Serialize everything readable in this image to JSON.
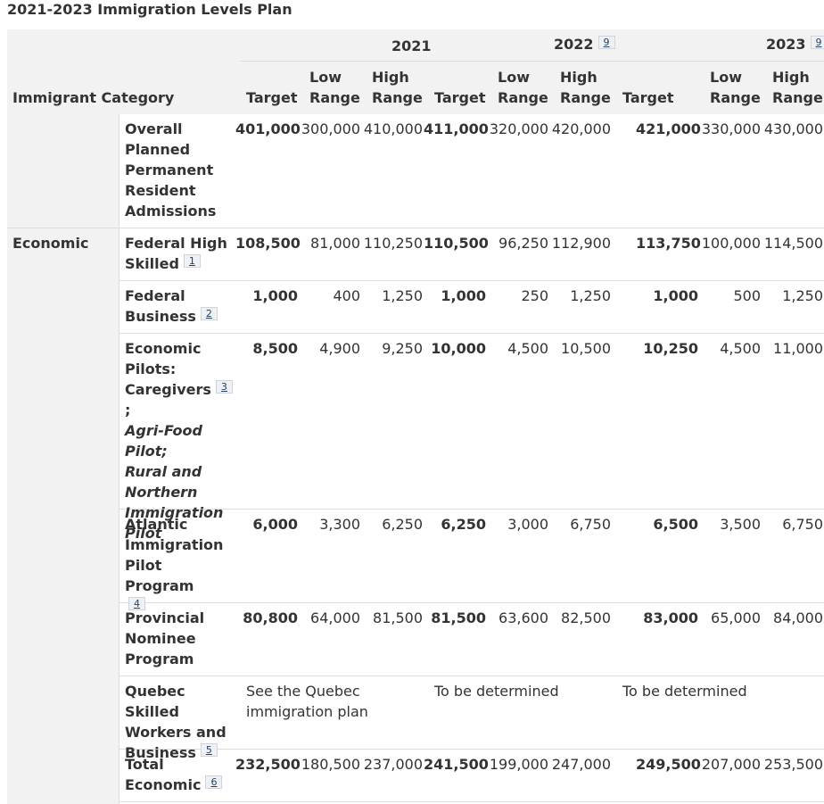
{
  "caption": "2021-2023 Immigration Levels Plan",
  "header": {
    "category_label": "Immigrant Category",
    "years": [
      {
        "year": "2021",
        "footnote": ""
      },
      {
        "year": "2022",
        "footnote": "9"
      },
      {
        "year": "2023",
        "footnote": "9"
      }
    ],
    "col_target": "Target",
    "col_low_1": "Low",
    "col_low_2": "Range",
    "col_high_1": "High",
    "col_high_2": "Range"
  },
  "rows": [
    {
      "category": "",
      "label": [
        "Overall",
        "Planned",
        "Permanent",
        "Resident",
        "Admissions"
      ],
      "footnote": "",
      "values": [
        "401,000",
        "300,000",
        "410,000",
        "411,000",
        "320,000",
        "420,000",
        "421,000",
        "330,000",
        "430,000"
      ]
    },
    {
      "category": "Economic",
      "label": [
        "Federal High",
        "Skilled"
      ],
      "footnote": "1",
      "values": [
        "108,500",
        "81,000",
        "110,250",
        "110,500",
        "96,250",
        "112,900",
        "113,750",
        "100,000",
        "114,500"
      ]
    },
    {
      "category": "",
      "label": [
        "Federal",
        "Business"
      ],
      "footnote": "2",
      "values": [
        "1,000",
        "400",
        "1,250",
        "1,000",
        "250",
        "1,250",
        "1,000",
        "500",
        "1,250"
      ]
    },
    {
      "category": "",
      "label": [
        "Economic",
        "Pilots:",
        "Caregivers"
      ],
      "footnote": "3",
      "label_suffix": ";",
      "label_italic": [
        "Agri-Food Pilot;",
        "Rural and",
        "Northern",
        "Immigration",
        "Pilot"
      ],
      "values": [
        "8,500",
        "4,900",
        "9,250",
        "10,000",
        "4,500",
        "10,500",
        "10,250",
        "4,500",
        "11,000"
      ]
    },
    {
      "category": "",
      "label": [
        "Atlantic",
        "Immigration",
        "Pilot Program"
      ],
      "footnote": "4",
      "values": [
        "6,000",
        "3,300",
        "6,250",
        "6,250",
        "3,000",
        "6,750",
        "6,500",
        "3,500",
        "6,750"
      ]
    },
    {
      "category": "",
      "label": [
        "Provincial",
        "Nominee",
        "Program"
      ],
      "footnote": "",
      "values": [
        "80,800",
        "64,000",
        "81,500",
        "81,500",
        "63,600",
        "82,500",
        "83,000",
        "65,000",
        "84,000"
      ]
    },
    {
      "category": "",
      "label": [
        "Quebec Skilled",
        "Workers and",
        "Business"
      ],
      "footnote": "5",
      "notes": {
        "y2021_line1": "See the Quebec",
        "y2021_line2": "immigration plan",
        "y2022": "To be determined",
        "y2023": "To be determined"
      }
    },
    {
      "category": "",
      "label": [
        "Total Economic"
      ],
      "footnote": "6",
      "values": [
        "232,500",
        "180,500",
        "237,000",
        "241,500",
        "199,000",
        "247,000",
        "249,500",
        "207,000",
        "253,500"
      ]
    }
  ]
}
